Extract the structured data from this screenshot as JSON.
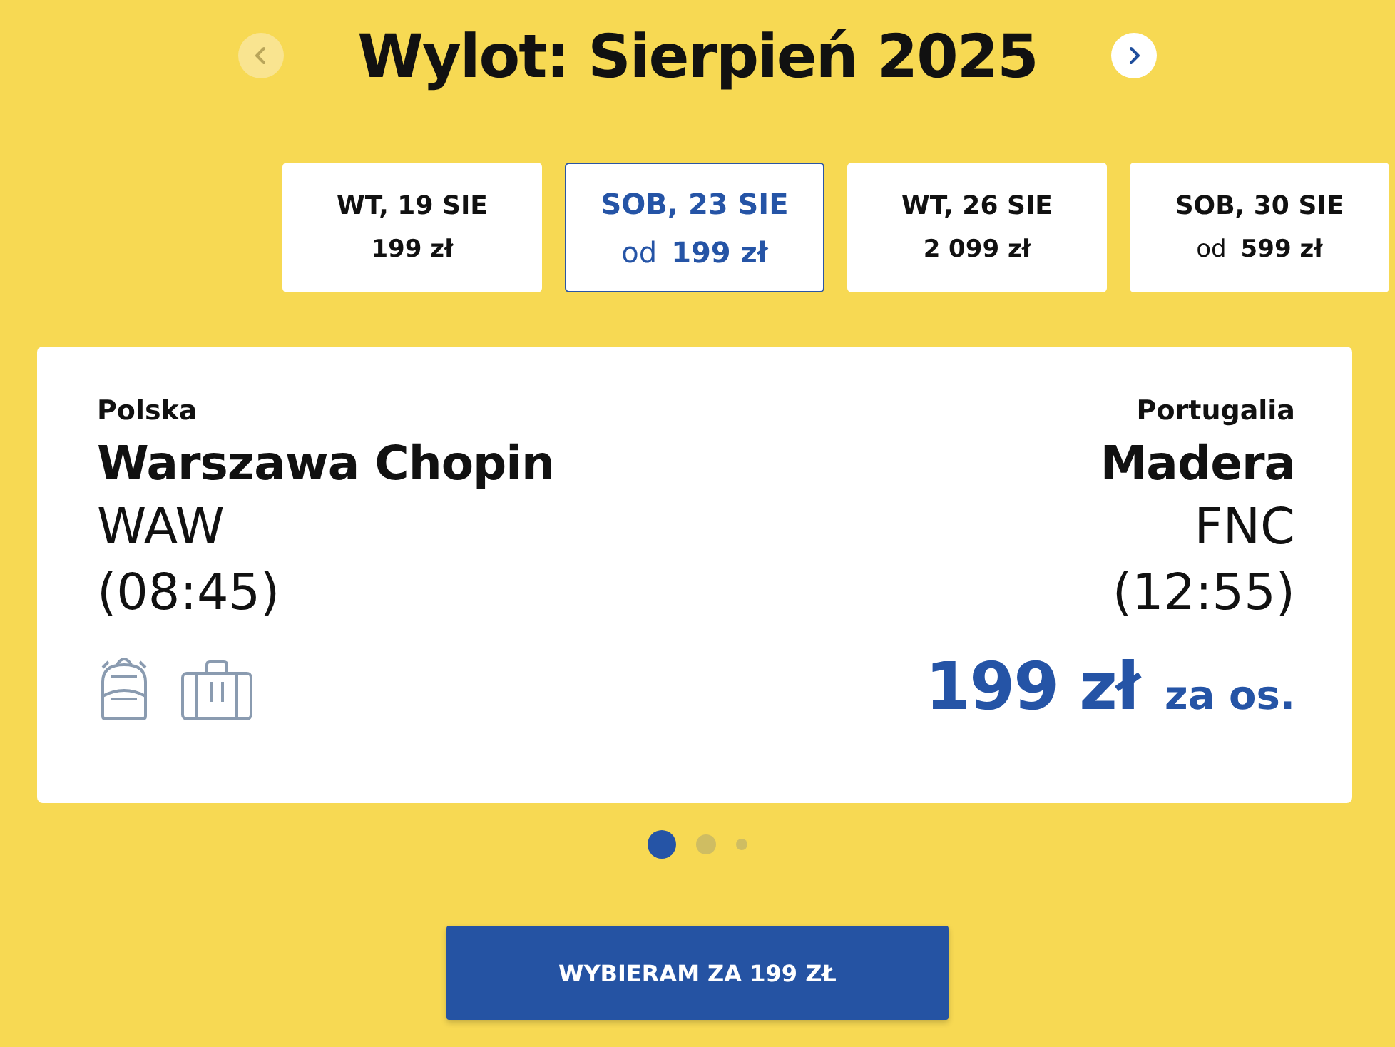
{
  "header": {
    "title": "Wylot: Sierpień 2025",
    "prev_disabled": true,
    "next_disabled": false
  },
  "dates": [
    {
      "day": "WT, 19 SIE",
      "price": "199 zł",
      "selected": false
    },
    {
      "day": "SOB, 23 SIE",
      "prefix": "od",
      "price": "199 zł",
      "selected": true
    },
    {
      "day": "WT, 26 SIE",
      "price": "2 099 zł",
      "selected": false
    },
    {
      "day": "SOB, 30 SIE",
      "prefix": "od",
      "price": "599 zł",
      "selected": false
    }
  ],
  "flight": {
    "origin": {
      "country": "Polska",
      "airport": "Warszawa Chopin",
      "code": "WAW",
      "time": "(08:45)"
    },
    "destination": {
      "country": "Portugalia",
      "airport": "Madera",
      "code": "FNC",
      "time": "(12:55)"
    },
    "price": "199 zł",
    "price_note": "za os."
  },
  "pager": [
    {
      "selected": true
    },
    {
      "selected": false
    },
    {
      "selected": false
    }
  ],
  "cta": "WYBIERAM ZA 199 ZŁ"
}
